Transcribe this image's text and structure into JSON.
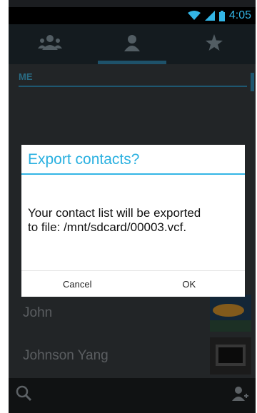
{
  "status_bar": {
    "time": "4:05"
  },
  "tabs": [
    {
      "label": "groups-icon",
      "selected": false
    },
    {
      "label": "person-icon",
      "selected": true
    },
    {
      "label": "star-icon",
      "selected": false
    }
  ],
  "list": {
    "section_header": "ME",
    "contacts": [
      {
        "name": "John"
      },
      {
        "name": "Johnson Yang"
      }
    ]
  },
  "dialog": {
    "title": "Export contacts?",
    "message": "Your contact list will be exported to file: /mnt/sdcard/00003.vcf.",
    "cancel_label": "Cancel",
    "ok_label": "OK"
  },
  "colors": {
    "accent": "#33b5e5",
    "background": "#35393d",
    "dialog": "#ffffff"
  }
}
